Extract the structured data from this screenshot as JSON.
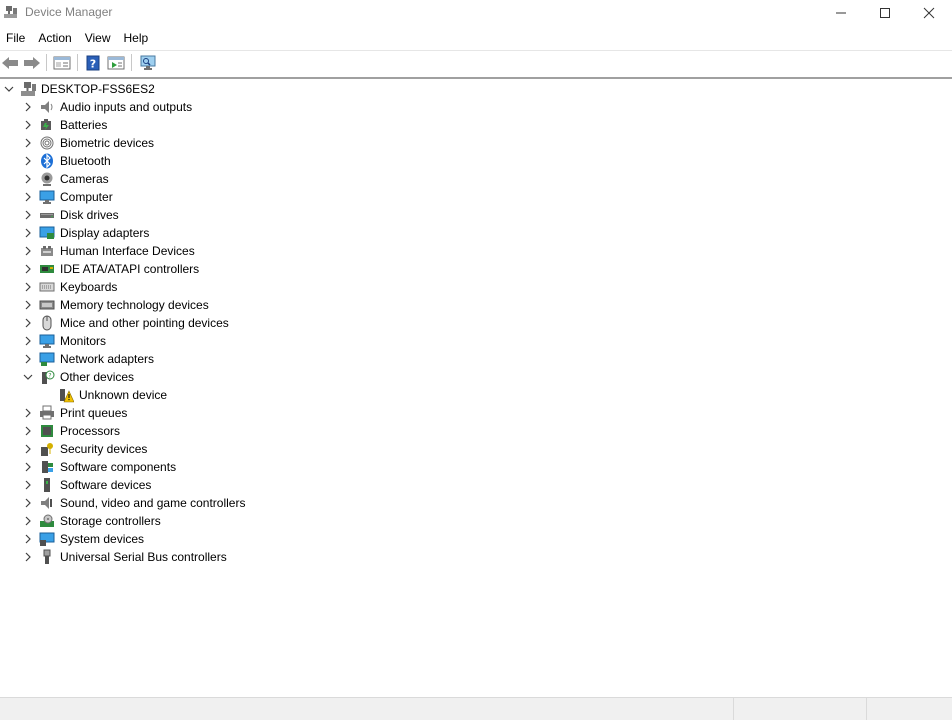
{
  "window": {
    "title": "Device Manager"
  },
  "menu": [
    "File",
    "Action",
    "View",
    "Help"
  ],
  "tree": {
    "root": "DESKTOP-FSS6ES2",
    "categories": [
      "Audio inputs and outputs",
      "Batteries",
      "Biometric devices",
      "Bluetooth",
      "Cameras",
      "Computer",
      "Disk drives",
      "Display adapters",
      "Human Interface Devices",
      "IDE ATA/ATAPI controllers",
      "Keyboards",
      "Memory technology devices",
      "Mice and other pointing devices",
      "Monitors",
      "Network adapters",
      "Other devices",
      "Unknown device",
      "Print queues",
      "Processors",
      "Security devices",
      "Software components",
      "Software devices",
      "Sound, video and game controllers",
      "Storage controllers",
      "System devices",
      "Universal Serial Bus controllers"
    ]
  },
  "icons": {
    "root": "computer-icon",
    "items": [
      "speaker-icon",
      "battery-icon",
      "fingerprint-icon",
      "bluetooth-icon",
      "camera-icon",
      "computer-icon",
      "disk-drive-icon",
      "display-adapter-icon",
      "hid-icon",
      "ide-controller-icon",
      "keyboard-icon",
      "memory-icon",
      "mouse-icon",
      "monitor-icon",
      "network-adapter-icon",
      "other-devices-icon",
      "unknown-device-warning-icon",
      "printer-icon",
      "processor-icon",
      "security-key-icon",
      "software-component-icon",
      "software-device-icon",
      "sound-icon",
      "storage-controller-icon",
      "system-devices-icon",
      "usb-icon"
    ]
  },
  "colors": {
    "accent": "#0078d7",
    "warning": "#f2c200",
    "title_text": "#808080"
  }
}
